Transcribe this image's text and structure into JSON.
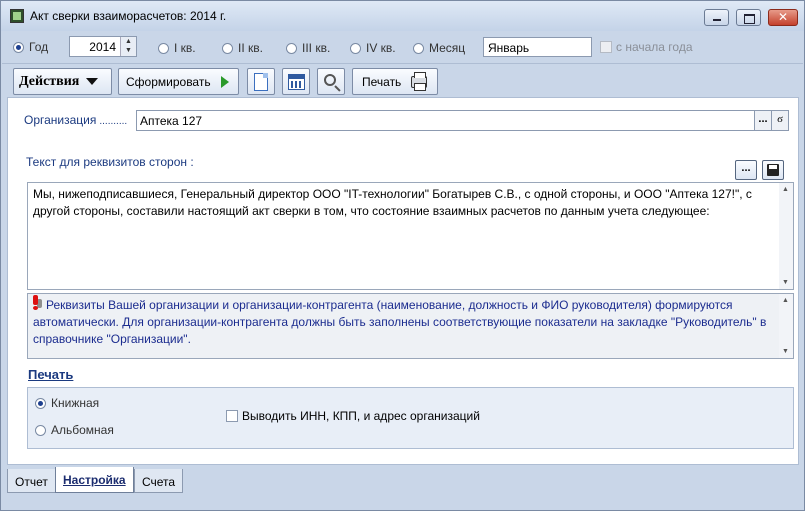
{
  "window": {
    "title": "Акт сверки взаиморасчетов: 2014 г."
  },
  "period": {
    "options": [
      {
        "label": "Год",
        "selected": true
      },
      {
        "label": "I кв.",
        "selected": false
      },
      {
        "label": "II кв.",
        "selected": false
      },
      {
        "label": "III кв.",
        "selected": false
      },
      {
        "label": "IV кв.",
        "selected": false
      },
      {
        "label": "Месяц",
        "selected": false
      }
    ],
    "year": "2014",
    "month": "Январь",
    "from_year_start_label": "с начала года"
  },
  "toolbar": {
    "actions_label": "Действия",
    "generate_label": "Сформировать",
    "print_label": "Печать"
  },
  "form": {
    "org_label": "Организация",
    "org_dots": "..........",
    "org_value": "Аптека 127",
    "more_button": "...",
    "requisites_label": "Текст для реквизитов сторон :",
    "requisites_text": "Мы, нижеподписавшиеся, Генеральный директор ООО \"IT-технологии\" Богатырев С.В., с одной стороны, и ООО \"Аптека 127!\", с другой стороны, составили настоящий акт сверки в том, что состояние взаимных расчетов по данным учета следующее:",
    "info_text": "Реквизиты Вашей организации и организации-контрагента (наименование, должность и ФИО руководителя) формируются автоматически. Для организации-контрагента должны быть заполнены соответствующие показатели на закладке \"Руководитель\" в справочнике \"Организации\"."
  },
  "print": {
    "heading": "Печать",
    "portrait_label": "Книжная",
    "landscape_label": "Альбомная",
    "inn_checkbox_label": "Выводить ИНН, КПП,  и адрес организаций"
  },
  "tabs": [
    {
      "label": "Отчет",
      "active": false
    },
    {
      "label": "Настройка",
      "active": true
    },
    {
      "label": "Счета",
      "active": false
    }
  ]
}
